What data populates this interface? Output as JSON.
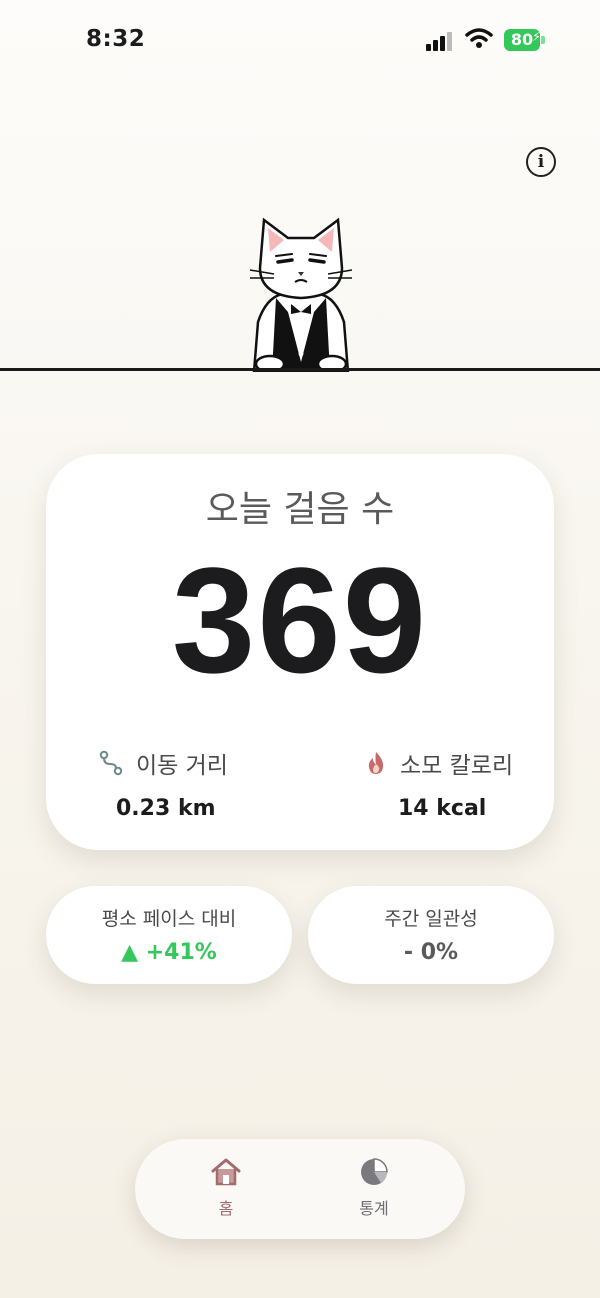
{
  "status_bar": {
    "time": "8:32",
    "battery": "80"
  },
  "header": {
    "info_icon": "info-icon"
  },
  "mascot": {
    "icon": "cat-butler-illustration"
  },
  "today": {
    "title": "오늘 걸음 수",
    "steps": "369",
    "distance_label": "이동 거리",
    "distance_value": "0.23 km",
    "calories_label": "소모 칼로리",
    "calories_value": "14 kcal"
  },
  "pace": {
    "label": "평소 페이스 대비",
    "value": "▲ +41%",
    "color": "#34c759"
  },
  "weekly": {
    "label": "주간 일관성",
    "value": "- 0%"
  },
  "tabs": [
    {
      "label": "홈",
      "icon": "home-icon",
      "active": true,
      "color": "#a36b6b"
    },
    {
      "label": "통계",
      "icon": "pie-chart-icon",
      "active": false,
      "color": "#6e6e73"
    }
  ]
}
